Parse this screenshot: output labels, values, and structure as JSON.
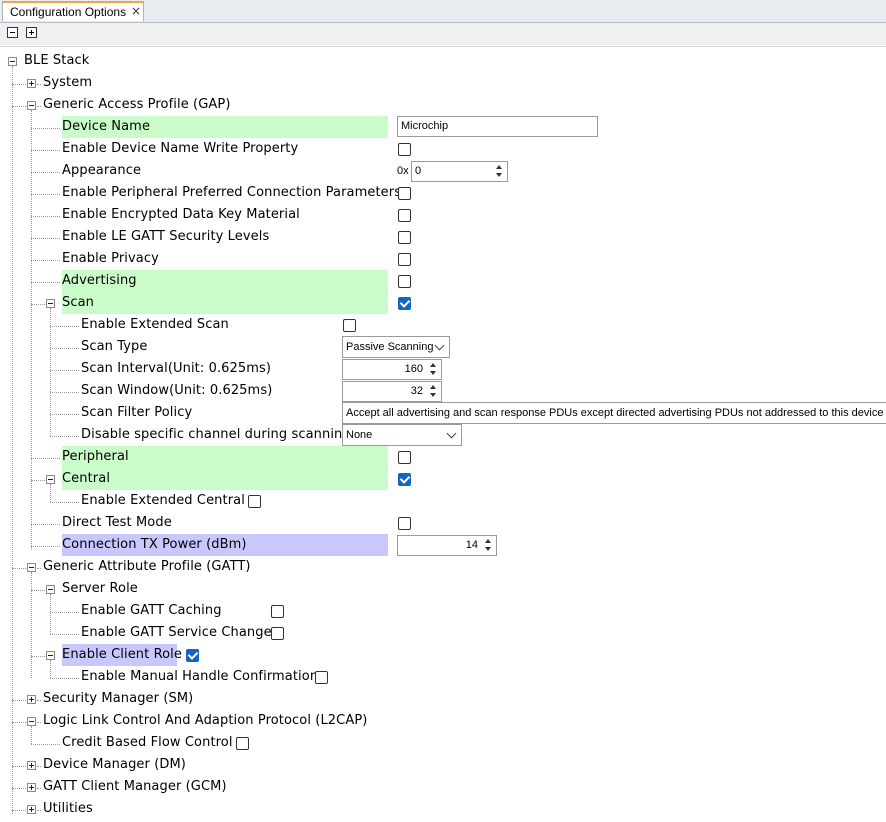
{
  "tab": {
    "title": "Configuration Options",
    "close": "×"
  },
  "tree": {
    "root": "BLE Stack",
    "system": "System",
    "gap": "Generic Access Profile (GAP)",
    "device_name": {
      "label": "Device Name",
      "value": "Microchip"
    },
    "enable_name_write": "Enable Device Name Write Property",
    "appearance": {
      "label": "Appearance",
      "prefix": "0x",
      "value": "0"
    },
    "pref_conn_params": "Enable Peripheral Preferred Connection Parameters",
    "encrypted_key": "Enable Encrypted Data Key Material",
    "gatt_security": "Enable LE GATT Security Levels",
    "privacy": "Enable Privacy",
    "advertising": "Advertising",
    "scan": "Scan",
    "ext_scan": "Enable Extended Scan",
    "scan_type": {
      "label": "Scan Type",
      "value": "Passive Scanning"
    },
    "scan_interval": {
      "label": "Scan Interval(Unit: 0.625ms)",
      "value": "160"
    },
    "scan_window": {
      "label": "Scan Window(Unit: 0.625ms)",
      "value": "32"
    },
    "scan_filter": {
      "label": "Scan Filter Policy",
      "value": "Accept all advertising and scan response PDUs except directed advertising PDUs not addressed to this device"
    },
    "disable_channel": {
      "label": "Disable specific channel during scanning",
      "value": "None"
    },
    "peripheral": "Peripheral",
    "central": "Central",
    "ext_central": "Enable Extended Central",
    "direct_test": "Direct Test Mode",
    "tx_power": {
      "label": "Connection TX Power (dBm)",
      "value": "14"
    },
    "gatt": "Generic Attribute Profile (GATT)",
    "server_role": "Server Role",
    "gatt_caching": "Enable GATT Caching",
    "gatt_service_change": "Enable GATT Service Change",
    "client_role": "Enable Client Role",
    "manual_handle": "Enable Manual Handle Confirmation",
    "sm": "Security Manager (SM)",
    "l2cap": "Logic Link Control And Adaption Protocol (L2CAP)",
    "credit_flow": "Credit Based Flow Control",
    "dm": "Device Manager (DM)",
    "gcm": "GATT Client Manager (GCM)",
    "utilities": "Utilities"
  },
  "colors": {
    "highlight_green": "#c9fcc9",
    "highlight_purple": "#c8c8ff",
    "checkbox_checked": "#1565c0"
  }
}
